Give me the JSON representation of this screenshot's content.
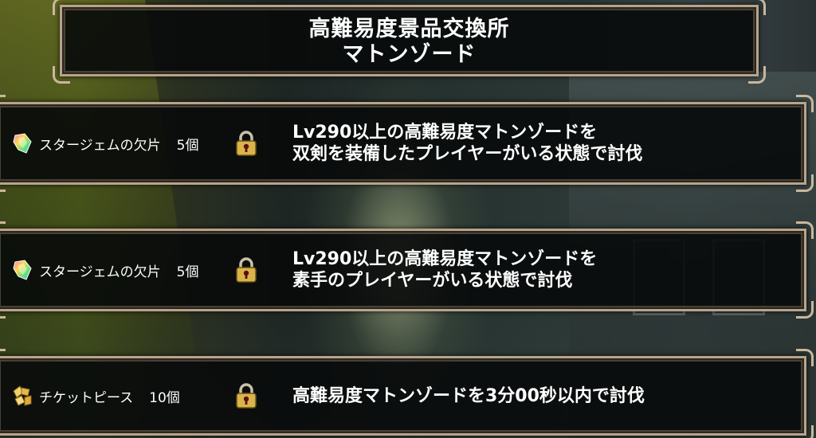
{
  "header": {
    "title_line1": "高難易度景品交換所",
    "title_line2": "マトンゾード"
  },
  "rewards": [
    {
      "item_icon": "star-gem-fragment-icon",
      "item_name": "スタージェムの欠片",
      "quantity": "5個",
      "locked": true,
      "condition_line1": "Lv290以上の高難易度マトンゾードを",
      "condition_line2": "双剣を装備したプレイヤーがいる状態で討伐"
    },
    {
      "item_icon": "star-gem-fragment-icon",
      "item_name": "スタージェムの欠片",
      "quantity": "5個",
      "locked": true,
      "condition_line1": "Lv290以上の高難易度マトンゾードを",
      "condition_line2": "素手のプレイヤーがいる状態で討伐"
    },
    {
      "item_icon": "ticket-piece-icon",
      "item_name": "チケットピース",
      "quantity": "10個",
      "locked": true,
      "condition_line1": "高難易度マトンゾードを3分00秒以内で討伐",
      "condition_line2": ""
    }
  ],
  "colors": {
    "frame_border": "#b7a48a",
    "panel_bg": "#080a0a",
    "lock_gold": "#d9b44a"
  }
}
